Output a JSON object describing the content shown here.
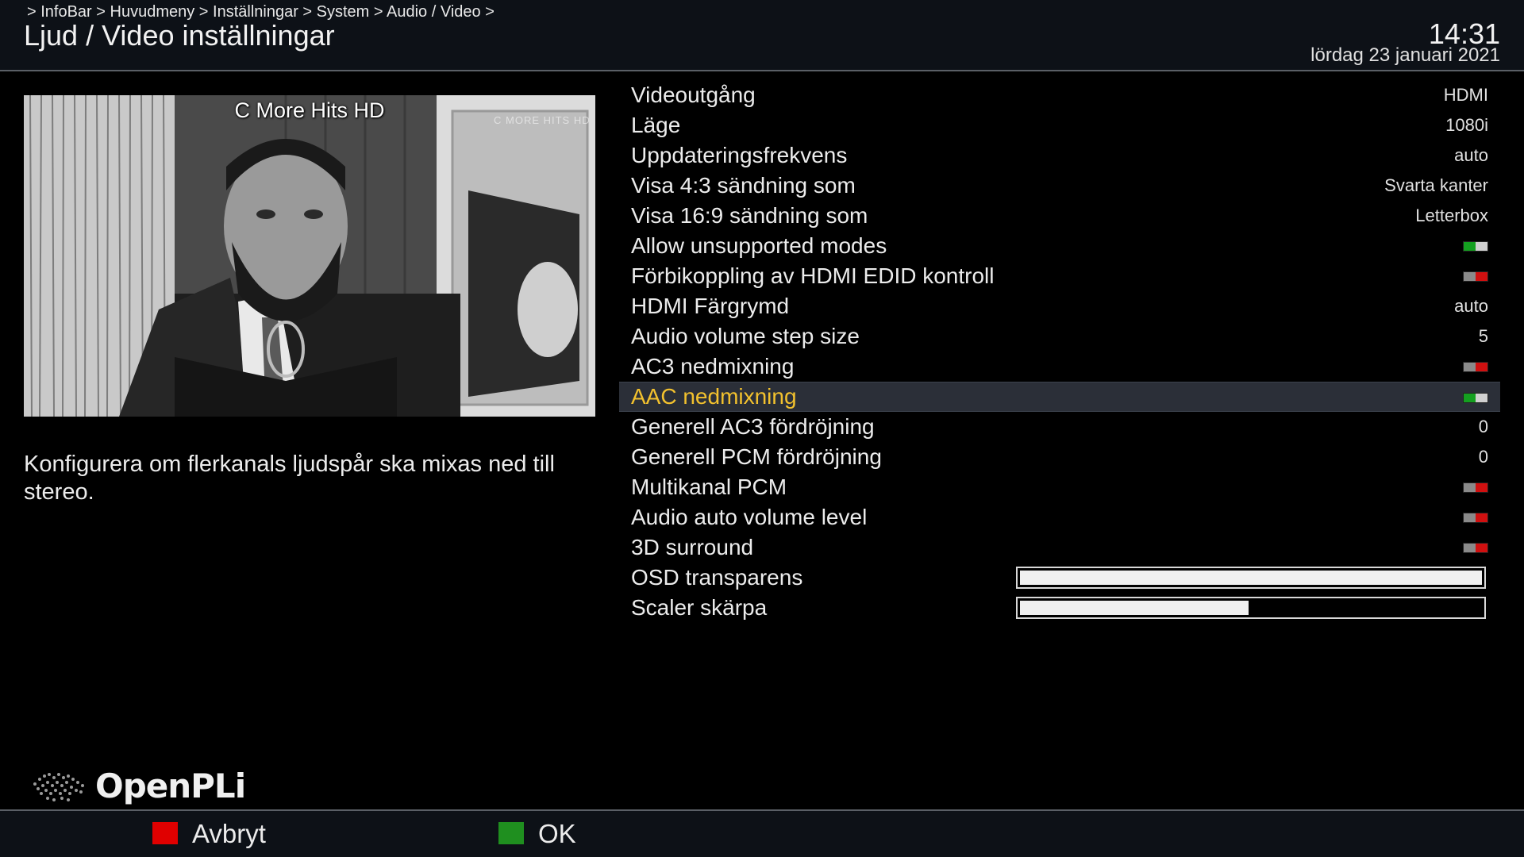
{
  "header": {
    "breadcrumb": " > InfoBar > Huvudmeny > Inställningar > System > Audio / Video >",
    "title": "Ljud / Video inställningar",
    "time": "14:31",
    "date": "lördag 23 januari 2021"
  },
  "preview": {
    "channel": "C More Hits HD",
    "watermark": "C MORE HITS HD"
  },
  "description": "Konfigurera om flerkanals ljudspår ska mixas ned till stereo.",
  "settings": [
    {
      "label": "Videoutgång",
      "type": "text",
      "value": "HDMI"
    },
    {
      "label": "Läge",
      "type": "text",
      "value": "1080i"
    },
    {
      "label": "Uppdateringsfrekvens",
      "type": "text",
      "value": "auto"
    },
    {
      "label": "Visa 4:3 sändning som",
      "type": "text",
      "value": "Svarta kanter"
    },
    {
      "label": "Visa 16:9 sändning som",
      "type": "text",
      "value": "Letterbox"
    },
    {
      "label": "Allow unsupported modes",
      "type": "toggle",
      "on": true
    },
    {
      "label": "Förbikoppling av HDMI EDID kontroll",
      "type": "toggle",
      "on": false
    },
    {
      "label": "HDMI Färgrymd",
      "type": "text",
      "value": "auto"
    },
    {
      "label": "Audio volume step size",
      "type": "text",
      "value": "5"
    },
    {
      "label": "AC3 nedmixning",
      "type": "toggle",
      "on": false
    },
    {
      "label": "AAC nedmixning",
      "type": "toggle",
      "on": true,
      "selected": true
    },
    {
      "label": "Generell AC3 fördröjning",
      "type": "text",
      "value": "0"
    },
    {
      "label": "Generell PCM fördröjning",
      "type": "text",
      "value": "0"
    },
    {
      "label": "Multikanal PCM",
      "type": "toggle",
      "on": false
    },
    {
      "label": "Audio auto volume level",
      "type": "toggle",
      "on": false
    },
    {
      "label": "3D surround",
      "type": "toggle",
      "on": false
    },
    {
      "label": "OSD transparens",
      "type": "slider",
      "level": 1.0
    },
    {
      "label": "Scaler skärpa",
      "type": "slider",
      "level": 0.5
    }
  ],
  "logo": {
    "text": "OpenPLi"
  },
  "footer": {
    "red_label": "Avbryt",
    "green_label": "OK",
    "red_color": "#e00000",
    "green_color": "#1f8f1f"
  },
  "colors": {
    "selected_label": "#f2c12e",
    "toggle_on": "#14a020",
    "toggle_off": "#d01010"
  }
}
